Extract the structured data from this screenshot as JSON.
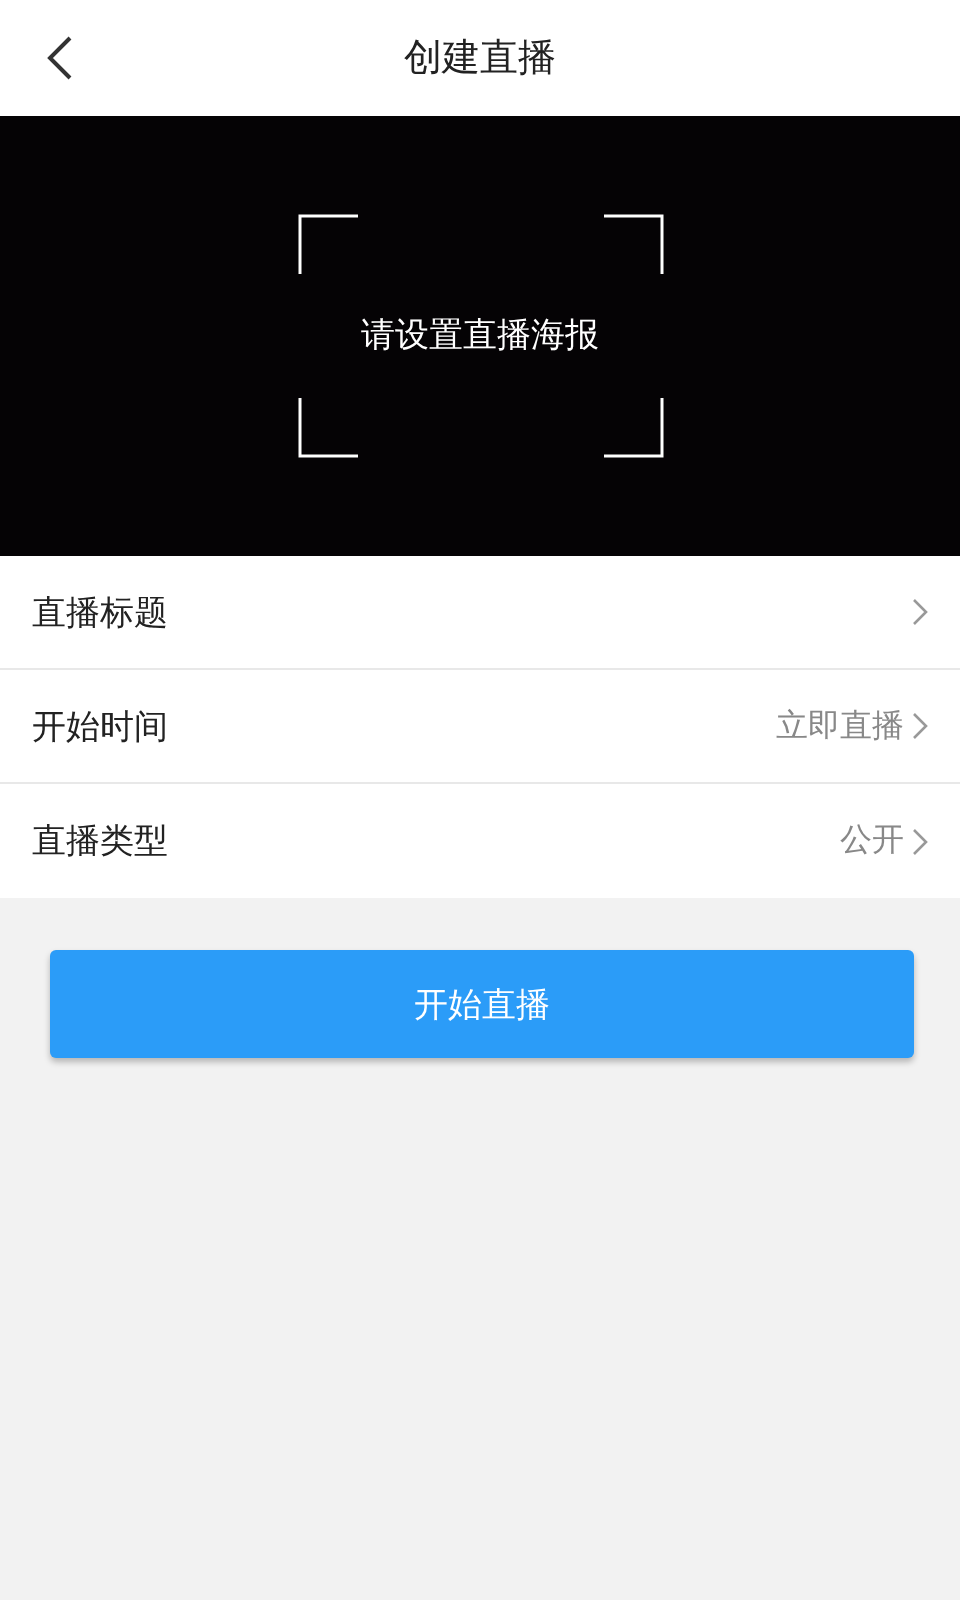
{
  "header": {
    "title": "创建直播"
  },
  "poster": {
    "prompt": "请设置直播海报"
  },
  "settings": [
    {
      "label": "直播标题"
    },
    {
      "label": "开始时间",
      "value": "立即直播"
    },
    {
      "label": "直播类型",
      "value": "公开"
    }
  ],
  "start_button": {
    "label": "开始直播"
  }
}
